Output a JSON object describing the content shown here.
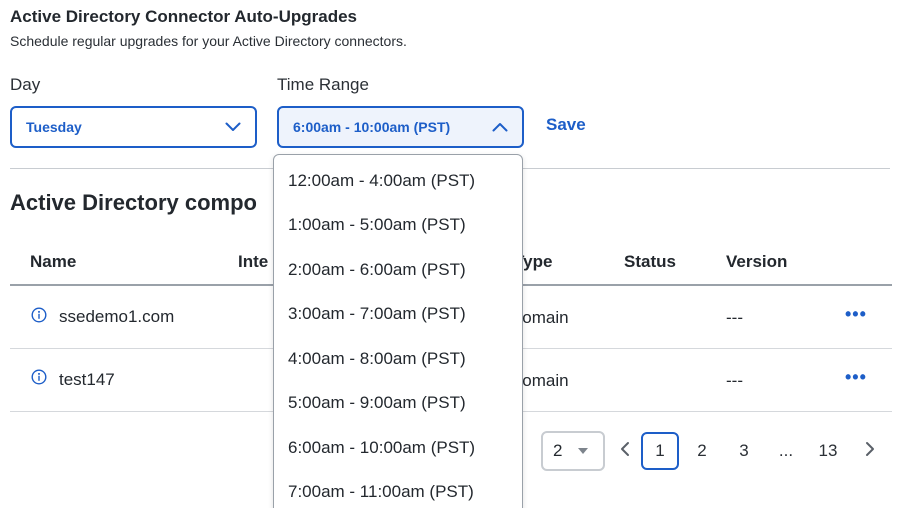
{
  "header": {
    "title": "Active Directory Connector Auto-Upgrades",
    "subtitle": "Schedule regular upgrades for your Active Directory connectors."
  },
  "form": {
    "day_label": "Day",
    "day_value": "Tuesday",
    "time_label": "Time Range",
    "time_value": "6:00am - 10:00am (PST)",
    "save_label": "Save",
    "time_options": [
      "12:00am - 4:00am (PST)",
      "1:00am - 5:00am (PST)",
      "2:00am - 6:00am (PST)",
      "3:00am - 7:00am (PST)",
      "4:00am - 8:00am (PST)",
      "5:00am - 9:00am (PST)",
      "6:00am - 10:00am (PST)",
      "7:00am - 11:00am (PST)"
    ]
  },
  "components": {
    "section_title": "Active Directory compo",
    "columns": {
      "name": "Name",
      "interface": "Inte",
      "type": "Type",
      "status": "Status",
      "version": "Version"
    },
    "rows": [
      {
        "name": "ssedemo1.com",
        "type": "Domain",
        "status": "",
        "version": "---",
        "actions": "•••"
      },
      {
        "name": "test147",
        "type": "Domain",
        "status": "",
        "version": "---",
        "actions": "•••"
      }
    ]
  },
  "pagination": {
    "page_size": "2",
    "pages": [
      "1",
      "2",
      "3",
      "...",
      "13"
    ],
    "current_page": "1"
  },
  "colors": {
    "accent": "#1d5ec8",
    "text": "#23282e",
    "divider": "#c8ccd1"
  }
}
